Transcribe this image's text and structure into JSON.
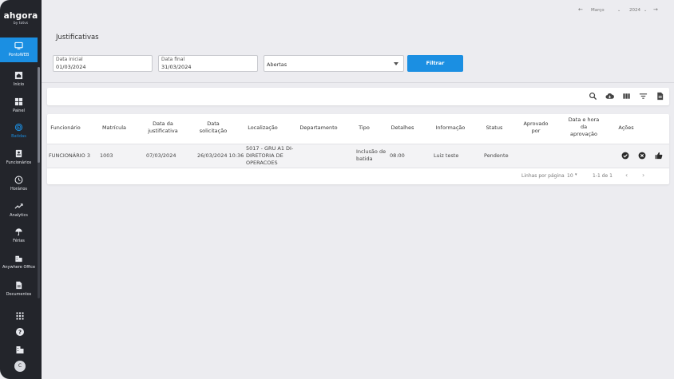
{
  "app": {
    "logo": "ahgora",
    "logo_sub": "by totvs"
  },
  "sidebar": {
    "items": [
      {
        "label": "PontoWEB",
        "icon": "monitor-icon"
      },
      {
        "label": "Início",
        "icon": "home-icon"
      },
      {
        "label": "Painel",
        "icon": "dashboard-icon"
      },
      {
        "label": "Batidas",
        "icon": "fingerprint-icon"
      },
      {
        "label": "Funcionários",
        "icon": "badge-icon"
      },
      {
        "label": "Horários",
        "icon": "clock-icon"
      },
      {
        "label": "Analytics",
        "icon": "trend-icon"
      },
      {
        "label": "Férias",
        "icon": "umbrella-icon"
      },
      {
        "label": "Anywhere Office",
        "icon": "building-icon"
      },
      {
        "label": "Documentos",
        "icon": "document-icon"
      }
    ],
    "avatar_initial": "C"
  },
  "period": {
    "month": "Março",
    "year": "2024"
  },
  "page": {
    "title": "Justificativas"
  },
  "filters": {
    "start_label": "Data inicial",
    "start_value": "01/03/2024",
    "end_label": "Data final",
    "end_value": "31/03/2024",
    "status_value": "Abertas",
    "button_label": "Filtrar"
  },
  "table": {
    "headers": [
      "Funcionário",
      "Matrícula",
      "Data da justificativa",
      "Data solicitação",
      "Localização",
      "Departamento",
      "Tipo",
      "Detalhes",
      "Informação",
      "Status",
      "Aprovado por",
      "Data e hora da aprovação",
      "Ações"
    ],
    "rows": [
      {
        "funcionario": "FUNCIONÁRIO 3",
        "matricula": "1003",
        "data_justificativa": "07/03/2024",
        "data_solicitacao": "26/03/2024 10:36",
        "localizacao": "5017 - GRU A1 DI-DIRETORIA DE OPERACOES",
        "departamento": "",
        "tipo": "Inclusão de batida",
        "detalhes": "08:00",
        "informacao": "Luiz teste",
        "status": "Pendente",
        "aprovado_por": "",
        "data_aprovacao": ""
      }
    ]
  },
  "pagination": {
    "rows_per_page_label": "Linhas por página",
    "rows_per_page": "10",
    "range": "1-1 de 1"
  },
  "colors": {
    "accent": "#1b8fe2",
    "sidebar_bg": "#23252b",
    "page_bg": "#ececf0"
  }
}
